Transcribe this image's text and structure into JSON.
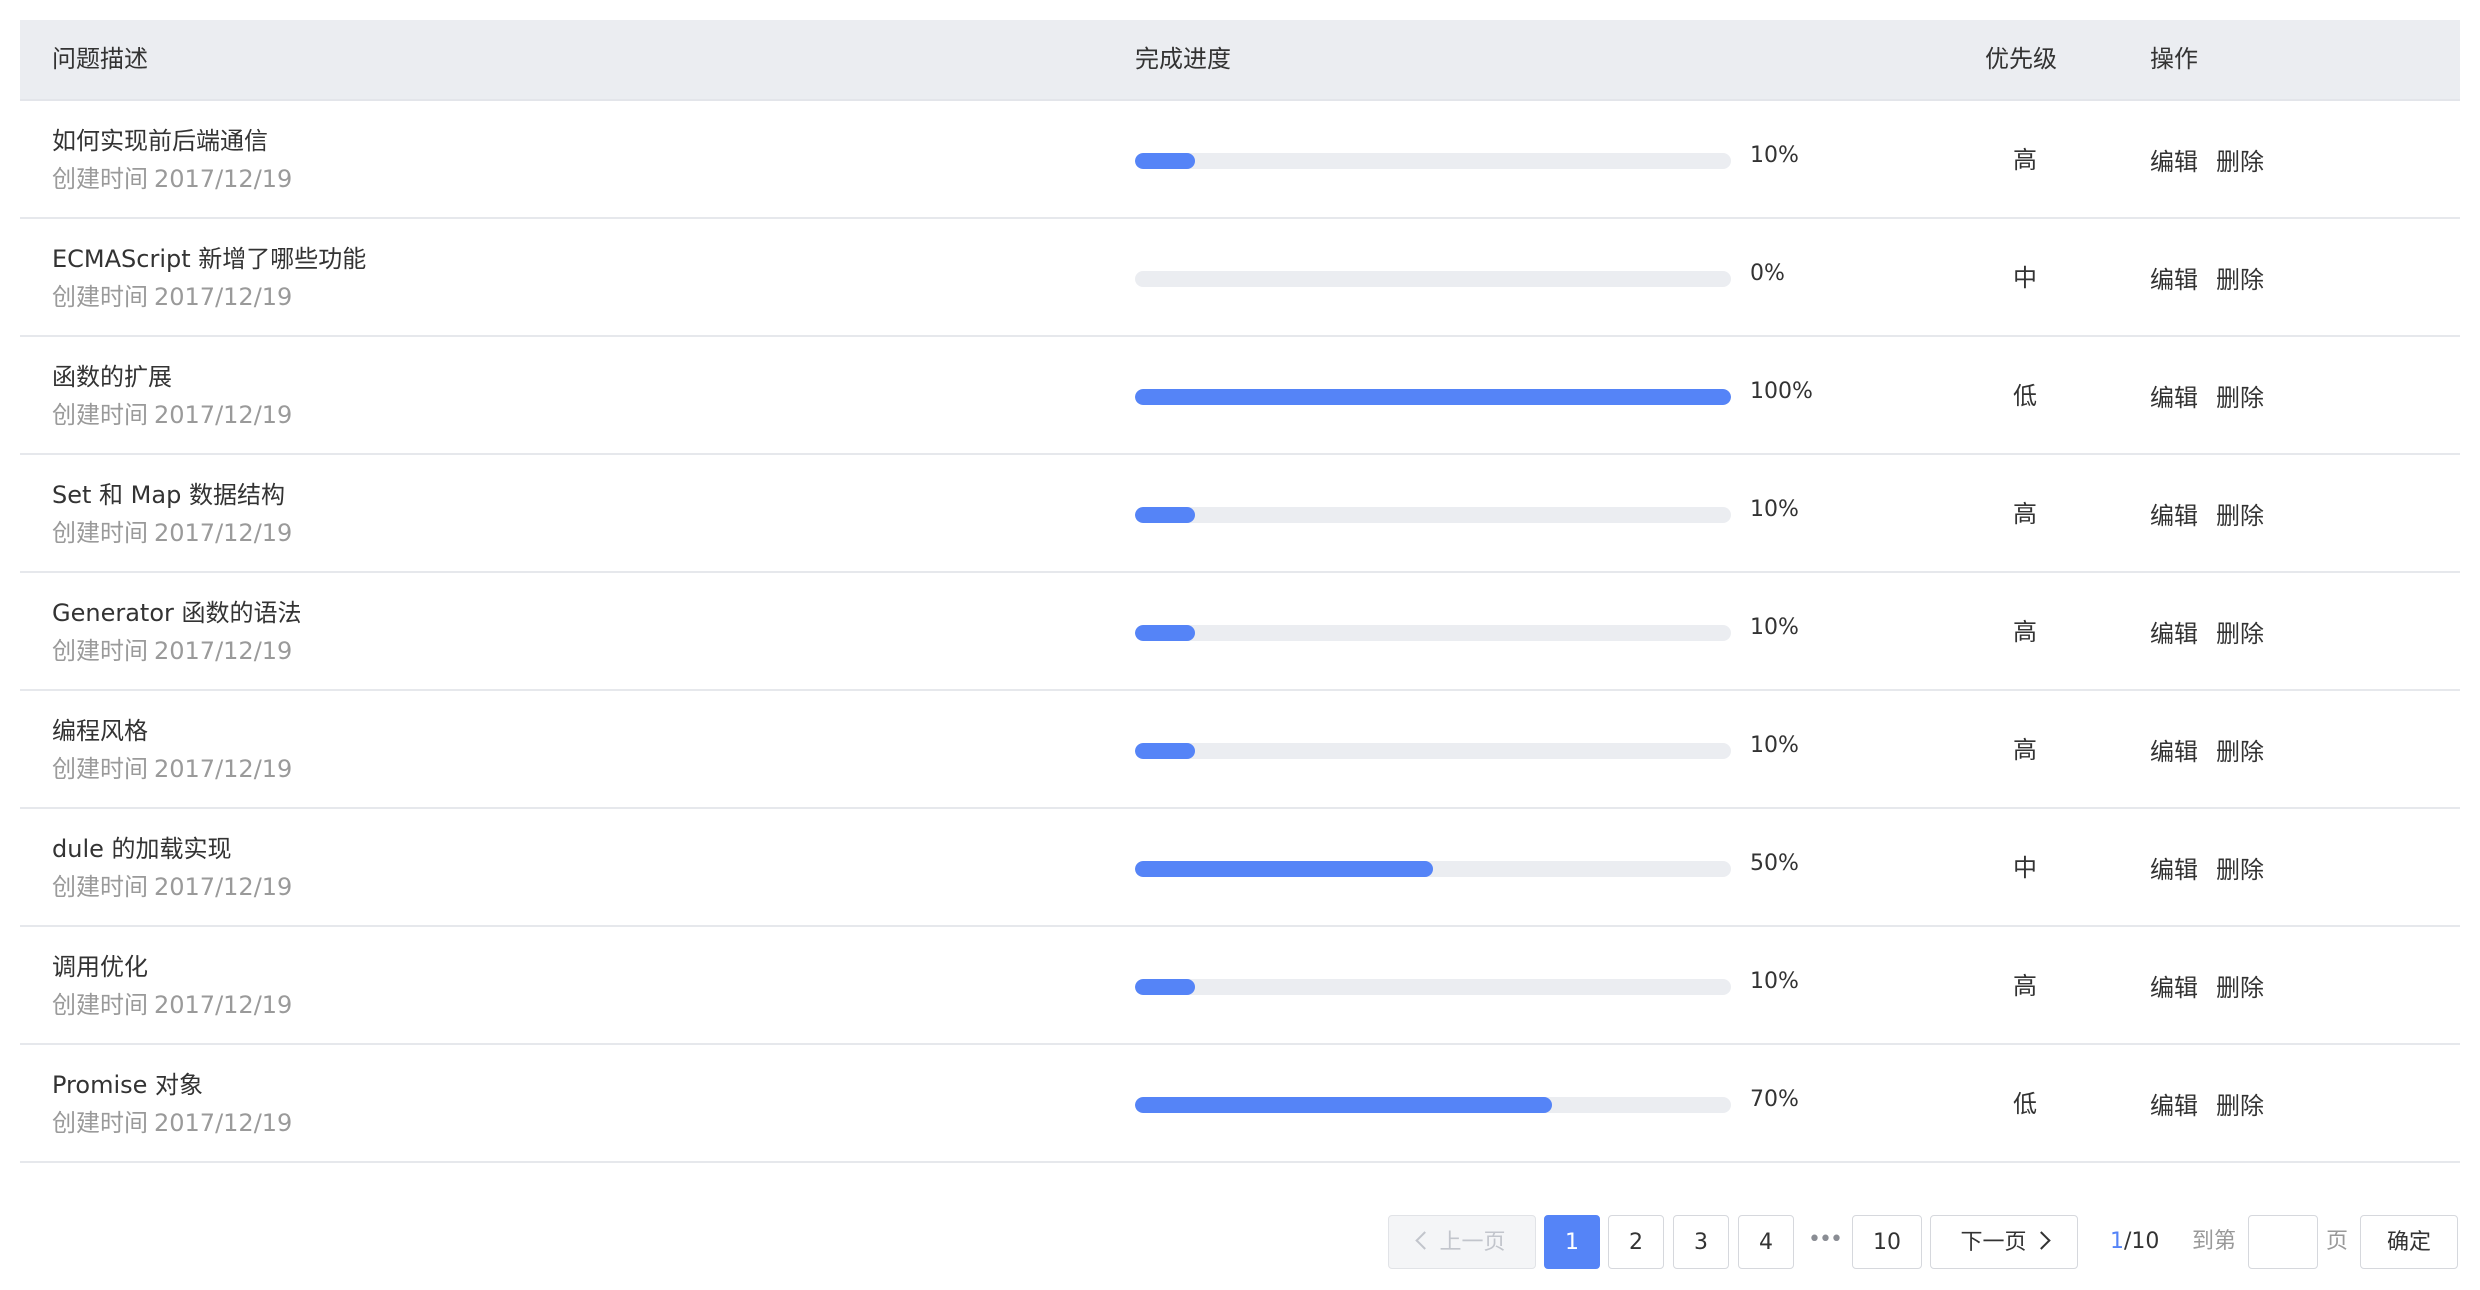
{
  "table": {
    "headers": {
      "description": "问题描述",
      "progress": "完成进度",
      "priority": "优先级",
      "actions": "操作"
    },
    "rows": [
      {
        "title": "如何实现前后端通信",
        "created_label": "创建时间",
        "created": "2017/12/19",
        "progress": 10,
        "progress_label": "10%",
        "priority": "高",
        "edit": "编辑",
        "delete": "删除"
      },
      {
        "title": "ECMAScript 新增了哪些功能",
        "created_label": "创建时间",
        "created": "2017/12/19",
        "progress": 0,
        "progress_label": "0%",
        "priority": "中",
        "edit": "编辑",
        "delete": "删除"
      },
      {
        "title": "函数的扩展",
        "created_label": "创建时间",
        "created": "2017/12/19",
        "progress": 100,
        "progress_label": "100%",
        "priority": "低",
        "edit": "编辑",
        "delete": "删除"
      },
      {
        "title": "Set 和 Map 数据结构",
        "created_label": "创建时间",
        "created": "2017/12/19",
        "progress": 10,
        "progress_label": "10%",
        "priority": "高",
        "edit": "编辑",
        "delete": "删除"
      },
      {
        "title": "Generator 函数的语法",
        "created_label": "创建时间",
        "created": "2017/12/19",
        "progress": 10,
        "progress_label": "10%",
        "priority": "高",
        "edit": "编辑",
        "delete": "删除"
      },
      {
        "title": "编程风格",
        "created_label": "创建时间",
        "created": "2017/12/19",
        "progress": 10,
        "progress_label": "10%",
        "priority": "高",
        "edit": "编辑",
        "delete": "删除"
      },
      {
        "title": "dule 的加载实现",
        "created_label": "创建时间",
        "created": "2017/12/19",
        "progress": 50,
        "progress_label": "50%",
        "priority": "中",
        "edit": "编辑",
        "delete": "删除"
      },
      {
        "title": "调用优化",
        "created_label": "创建时间",
        "created": "2017/12/19",
        "progress": 10,
        "progress_label": "10%",
        "priority": "高",
        "edit": "编辑",
        "delete": "删除"
      },
      {
        "title": "Promise 对象",
        "created_label": "创建时间",
        "created": "2017/12/19",
        "progress": 70,
        "progress_label": "70%",
        "priority": "低",
        "edit": "编辑",
        "delete": "删除"
      }
    ]
  },
  "pagination": {
    "prev_label": "上一页",
    "next_label": "下一页",
    "pages": [
      "1",
      "2",
      "3",
      "4"
    ],
    "ellipsis": "•••",
    "last_page": "10",
    "current": "1",
    "total_separator": "/10",
    "goto_prefix": "到第",
    "goto_suffix": "页",
    "goto_value": "",
    "confirm_label": "确定"
  },
  "colors": {
    "accent": "#5584f7",
    "header_bg": "#ebedf1",
    "track_bg": "#ebedf1",
    "muted_text": "#9a9a9a"
  }
}
